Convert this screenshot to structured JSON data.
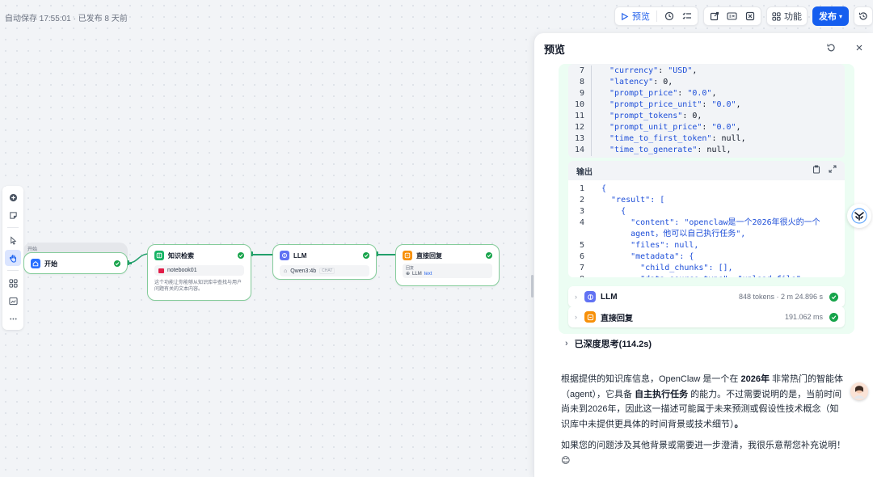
{
  "status": {
    "autosave": "自动保存 17:55:01 · 已发布 8 天前"
  },
  "toolbar": {
    "preview_label": "预览",
    "features_label": "功能",
    "publish_label": "发布"
  },
  "workflow": {
    "start_tag": "开始",
    "nodes": [
      {
        "title": "开始",
        "icon": "home-icon",
        "color": "#2970ff"
      },
      {
        "title": "知识检索",
        "icon": "book-icon",
        "color": "#16b364",
        "chip": "notebook01",
        "desc": "这个功能让你能够从知识库中查找与用户问题有关的文本内容。"
      },
      {
        "title": "LLM",
        "icon": "llm-icon",
        "color": "#6172f3",
        "chip": "Qwen3:4b",
        "chip_tag": "CHAT"
      },
      {
        "title": "直接回复",
        "icon": "reply-icon",
        "color": "#f79009",
        "section": "回复",
        "chip": "LLM",
        "chip_tag": "text"
      }
    ]
  },
  "panel": {
    "title": "预览",
    "code_lines": [
      {
        "n": "7",
        "k": "\"currency\"",
        "v": "\"USD\"",
        "t": "str"
      },
      {
        "n": "8",
        "k": "\"latency\"",
        "v": "0",
        "t": "num"
      },
      {
        "n": "9",
        "k": "\"prompt_price\"",
        "v": "\"0.0\"",
        "t": "str"
      },
      {
        "n": "10",
        "k": "\"prompt_price_unit\"",
        "v": "\"0.0\"",
        "t": "str"
      },
      {
        "n": "11",
        "k": "\"prompt_tokens\"",
        "v": "0",
        "t": "num"
      },
      {
        "n": "12",
        "k": "\"prompt_unit_price\"",
        "v": "\"0.0\"",
        "t": "str"
      },
      {
        "n": "13",
        "k": "\"time_to_first_token\"",
        "v": "null",
        "t": "num"
      },
      {
        "n": "14",
        "k": "\"time_to_generate\"",
        "v": "null",
        "t": "num"
      }
    ],
    "output_label": "输出",
    "output_lines": [
      {
        "n": "1",
        "text": "{"
      },
      {
        "n": "2",
        "text": "  \"result\": ["
      },
      {
        "n": "3",
        "text": "    {"
      },
      {
        "n": "4",
        "text": "      \"content\": \"openclaw是一个2026年很火的一个"
      },
      {
        "n": "",
        "text": "      agent，他可以自己执行任务\","
      },
      {
        "n": "5",
        "text": "      \"files\": null,"
      },
      {
        "n": "6",
        "text": "      \"metadata\": {"
      },
      {
        "n": "7",
        "text": "        \"child_chunks\": [],"
      },
      {
        "n": "8",
        "text": "        \"data_source_type\": \"upload_file\""
      }
    ],
    "steps": [
      {
        "name": "LLM",
        "meta": "848 tokens · 2 m 24.896 s",
        "color": "#6172f3",
        "icon": "llm-icon"
      },
      {
        "name": "直接回复",
        "meta": "191.062 ms",
        "color": "#f79009",
        "icon": "reply-icon"
      }
    ],
    "thinking": "已深度思考(114.2s)",
    "answer": {
      "p1_a": "根据提供的知识库信息，OpenClaw 是一个在 ",
      "p1_b": "2026年",
      "p1_c": " 非常热门的智能体（agent），它具备 ",
      "p1_d": "自主执行任务",
      "p1_e": " 的能力。不过需要说明的是，当前时间尚未到2026年，因此这一描述可能属于未来预测或假设性技术概念（知识库中未提供更具体的时间背景或技术细节）",
      "p1_f": "。",
      "p2": "如果您的问题涉及其他背景或需要进一步澄清，我很乐意帮您补充说明！",
      "emoji": "😊"
    }
  }
}
